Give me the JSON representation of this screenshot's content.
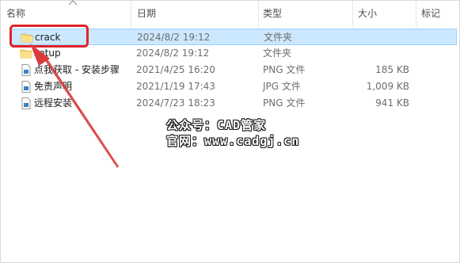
{
  "columns": {
    "name": "名称",
    "date": "日期",
    "type": "类型",
    "size": "大小",
    "tags": "标记"
  },
  "files": [
    {
      "name": "crack",
      "date": "2024/8/2 19:12",
      "type": "文件夹",
      "size": "",
      "icon": "folder-icon",
      "selected": true
    },
    {
      "name": "setup",
      "date": "2024/8/2 19:12",
      "type": "文件夹",
      "size": "",
      "icon": "folder-icon",
      "selected": false
    },
    {
      "name": "点我获取 - 安装步骤",
      "date": "2021/4/25 16:20",
      "type": "PNG 文件",
      "size": "185 KB",
      "icon": "image-file-icon",
      "selected": false
    },
    {
      "name": "免责声明",
      "date": "2021/1/19 17:43",
      "type": "JPG 文件",
      "size": "1,009 KB",
      "icon": "image-file-icon",
      "selected": false
    },
    {
      "name": "远程安装",
      "date": "2024/7/23 18:23",
      "type": "PNG 文件",
      "size": "941 KB",
      "icon": "image-file-icon",
      "selected": false
    }
  ],
  "watermark": {
    "line1": "公众号：CAD管家",
    "line2": "官网：www.cadgj.cn"
  },
  "colors": {
    "selection": "#cce8ff",
    "highlight_box": "#e0232b",
    "arrow": "#d93a3a",
    "folder": "#f8d775"
  }
}
